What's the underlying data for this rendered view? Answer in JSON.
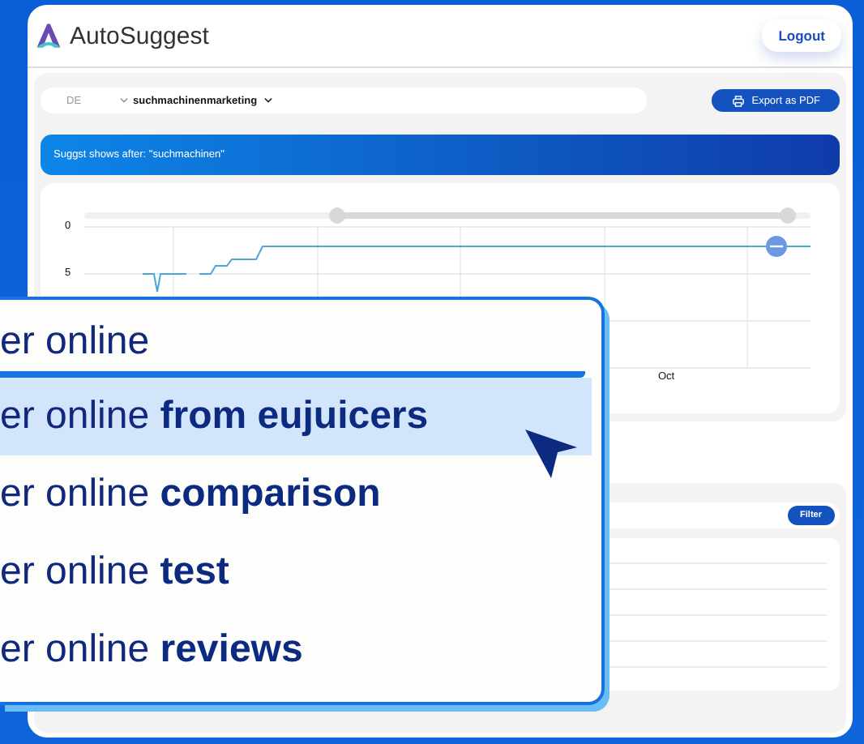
{
  "app": {
    "title": "AutoSuggest",
    "logout": "Logout"
  },
  "toolbar": {
    "country": "DE",
    "keyword": "suchmachinenmarketing",
    "export": "Export as PDF"
  },
  "banner": "Suggst shows after: \"suchmachinen\"",
  "chart": {
    "ytick_labels": [
      "0",
      "5"
    ],
    "xtick_labels": [
      "Oct"
    ],
    "range_start": {
      "level": 0.348
    },
    "range_end": {
      "level": 0.969
    }
  },
  "table": {
    "filter": "Filter"
  },
  "search_field": {
    "value": "er online"
  },
  "suggestions": [
    {
      "text": "er online **from eujuicers**",
      "selected": true
    },
    {
      "text": "er online **comparison**",
      "selected": false
    },
    {
      "text": "er online **test**",
      "selected": false
    },
    {
      "text": "er online **reviews**",
      "selected": false
    }
  ]
}
